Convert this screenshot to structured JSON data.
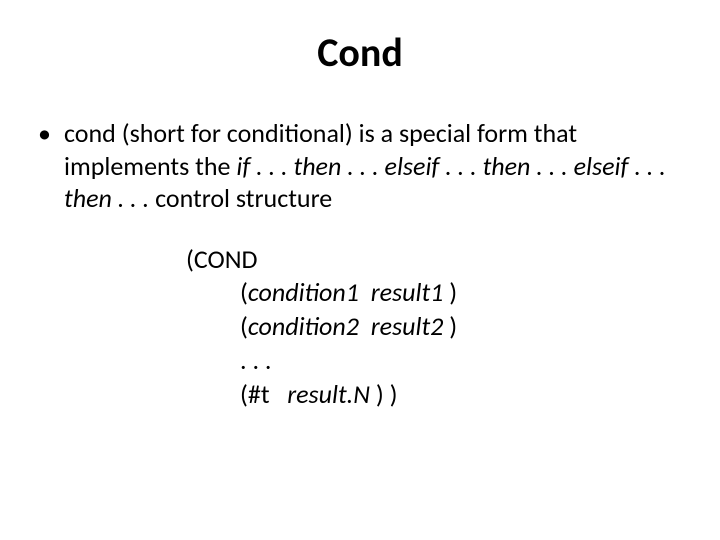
{
  "title": "Cond",
  "bullet": {
    "mark": "•",
    "seg1": "cond (short for conditional) is a special form that implements the ",
    "seg2_it": "if . . . then . . . elseif . . . then . . . elseif . . . then . . . ",
    "seg3": "control structure"
  },
  "code": {
    "l1": "(COND",
    "l2_open": "(",
    "l2_a_it": "condition1",
    "l2_gap": "  ",
    "l2_b_it": "result1",
    "l2_close": " )",
    "l3_open": "(",
    "l3_a_it": "condition2",
    "l3_gap": "  ",
    "l3_b_it": "result2",
    "l3_close": " )",
    "l4": ". . .",
    "l5_open": "(#t   ",
    "l5_it": "result.N",
    "l5_close": " ) )"
  }
}
